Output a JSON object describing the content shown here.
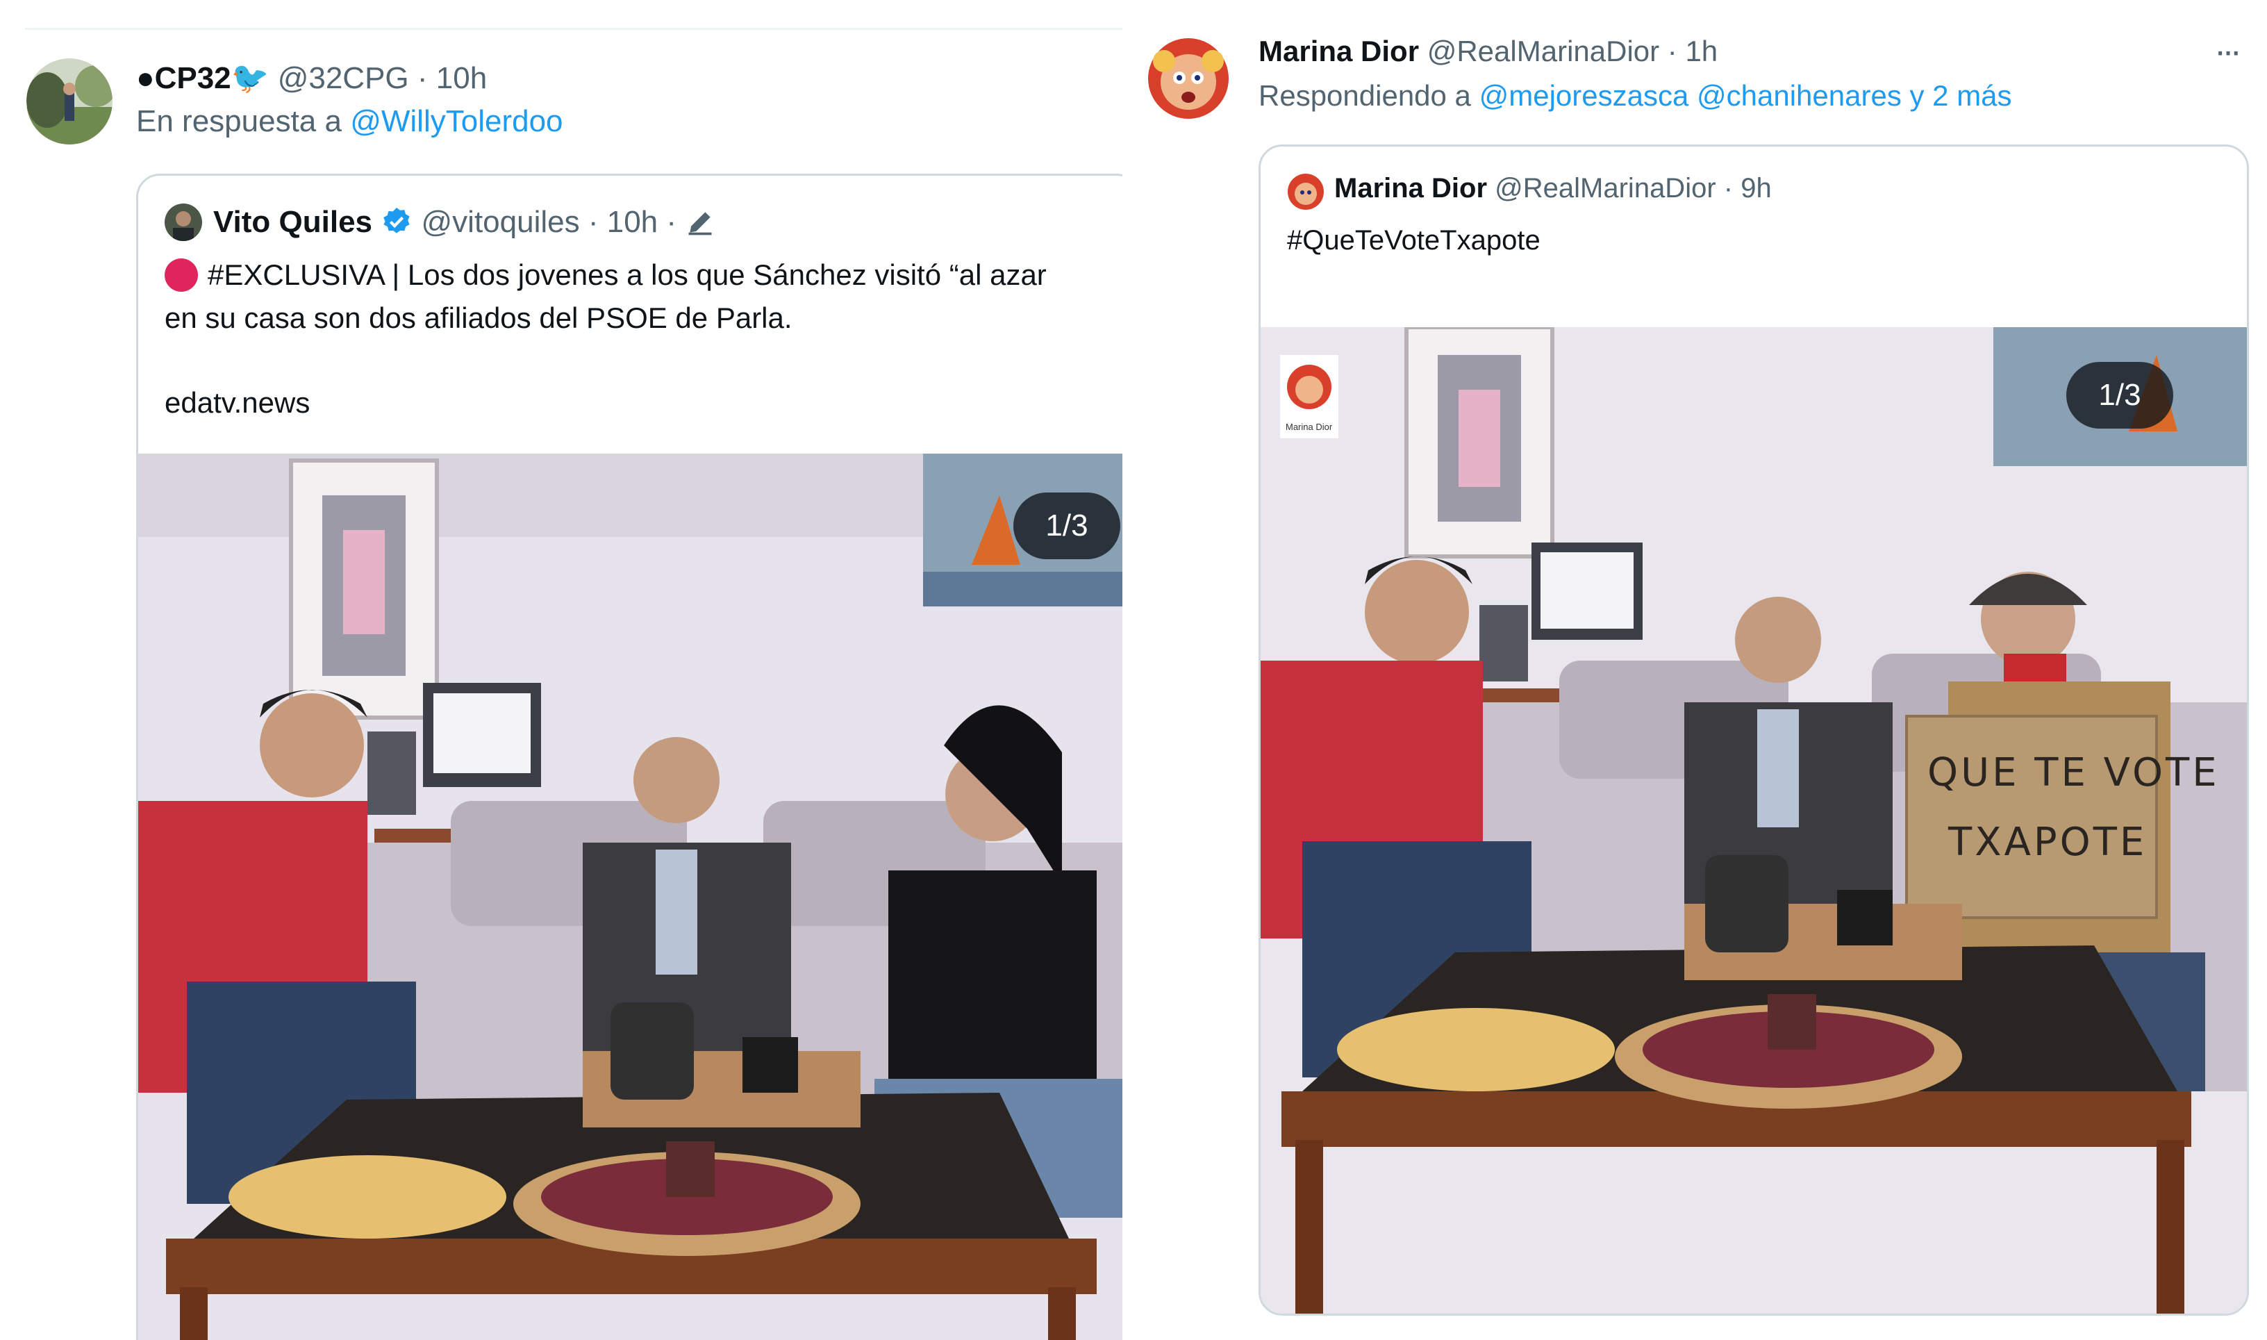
{
  "left_tweet": {
    "display_name": "CP32",
    "handle": "@32CPG",
    "time": "· 10h",
    "reply_prefix": "En respuesta a",
    "reply_to": "@WillyTolerdoo",
    "quoted": {
      "display_name": "Vito Quiles",
      "handle": "@vitoquiles",
      "time": "· 10h ·",
      "line1": "#EXCLUSIVA | Los dos jovenes a los que Sánchez visitó “al azar",
      "line2": "en su casa son dos afiliados del PSOE de Parla.",
      "link": "edatv.news",
      "image_counter": "1/3"
    }
  },
  "right_tweet": {
    "display_name": "Marina Dior",
    "handle": "@RealMarinaDior",
    "time": "· 1h",
    "reply_prefix": "Respondiendo a",
    "reply_to_1": "@mejoreszasca",
    "reply_to_2": "@chanihenares",
    "reply_more": "y 2 más",
    "more_menu": "···",
    "quoted": {
      "display_name": "Marina Dior",
      "handle": "@RealMarinaDior",
      "time": "· 9h",
      "text": "#QueTeVoteTxapote",
      "image_counter": "1/3",
      "placard_line1": "QUE TE VOTE",
      "placard_line2": "TXAPOTE",
      "watermark_name": "Marina Dior"
    }
  },
  "colors": {
    "accent": "#1d9bf0",
    "muted": "#536471",
    "border": "#cfd9de",
    "verified": "#1d9bf0",
    "red_dot": "#e0245e"
  }
}
